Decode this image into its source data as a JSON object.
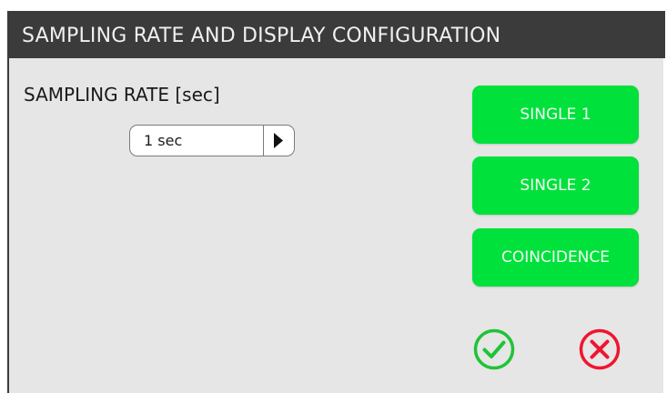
{
  "dialog": {
    "title": "SAMPLING RATE AND DISPLAY CONFIGURATION"
  },
  "sampling": {
    "label": "SAMPLING RATE [sec]",
    "selected_value": "1 sec",
    "next_icon": "triangle-right-icon"
  },
  "buttons": {
    "single1": "SINGLE 1",
    "single2": "SINGLE 2",
    "coincidence": "COINCIDENCE"
  },
  "actions": {
    "confirm_icon": "check-circle-icon",
    "cancel_icon": "x-circle-icon"
  },
  "colors": {
    "title_bg": "#3b3b3b",
    "panel_bg": "#e6e6e6",
    "button_green": "#00e13b",
    "confirm_green": "#1ec437",
    "cancel_red": "#f0152f"
  }
}
